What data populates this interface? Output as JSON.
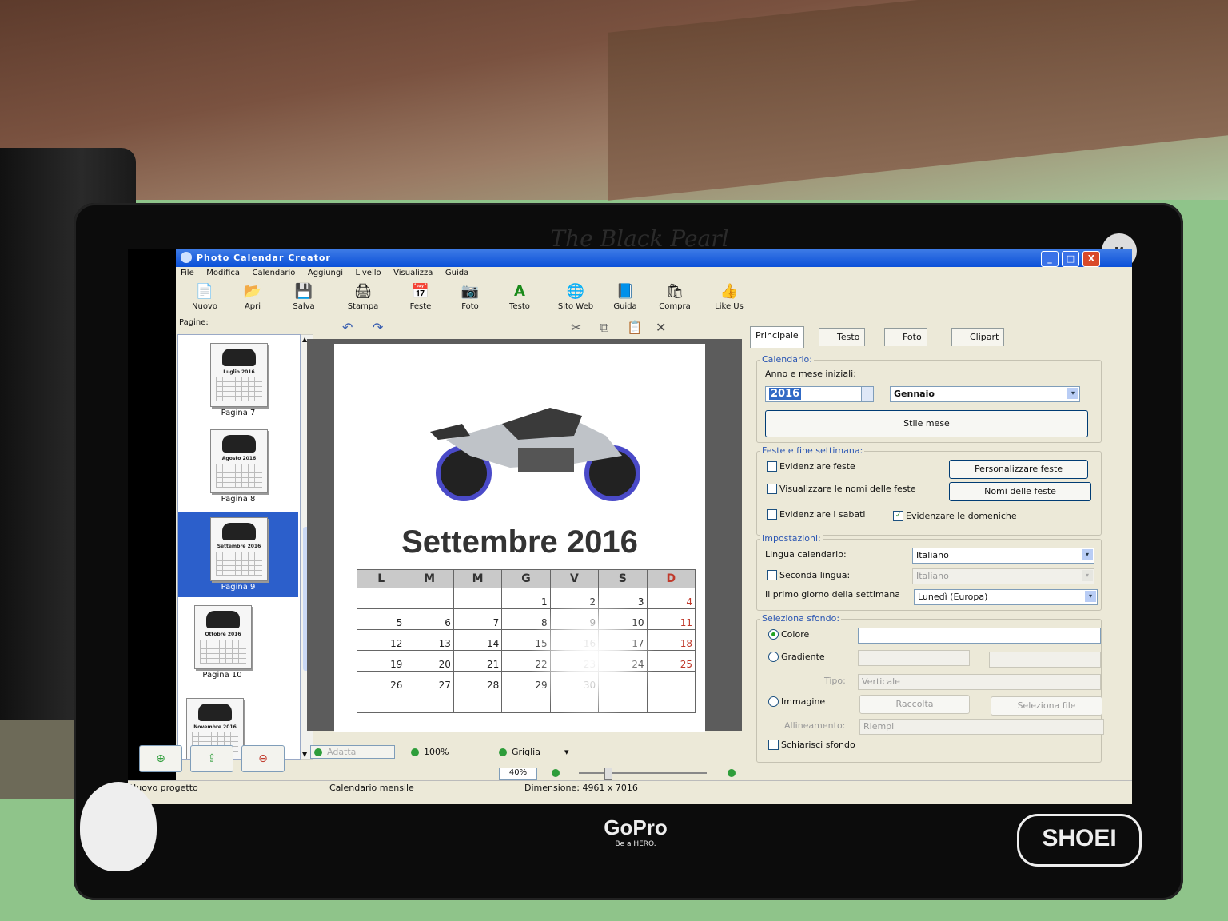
{
  "environment": {
    "monitor_brand": "The Black Pearl",
    "corner_badge": "M",
    "gopro_brand": "GoPro",
    "gopro_slogan": "Be a HERO.",
    "shoei_brand": "SHOEI"
  },
  "window": {
    "title": "Photo Calendar Creator",
    "minimize": "_",
    "maximize": "□",
    "close": "X"
  },
  "menu": [
    "File",
    "Modifica",
    "Calendario",
    "Aggiungi",
    "Livello",
    "Visualizza",
    "Guida"
  ],
  "toolbar": {
    "nuovo": "Nuovo",
    "apri": "Apri",
    "salva": "Salva",
    "stampa": "Stampa",
    "feste": "Feste",
    "foto": "Foto",
    "testo": "Testo",
    "sito_web": "Sito Web",
    "guida": "Guida",
    "compra": "Compra",
    "like_us": "Like Us"
  },
  "icons": {
    "nuovo": "📄",
    "apri": "📂",
    "salva": "💾",
    "stampa": "🖨",
    "feste": "📅",
    "foto": "📷",
    "testo": "A",
    "sito_web": "🌐",
    "guida": "📘",
    "compra": "🛍",
    "like_us": "👍",
    "undo": "↶",
    "redo": "↷",
    "cut": "✂",
    "copy": "⧉",
    "paste": "📋",
    "delete": "✕",
    "scroll_up": "▲",
    "scroll_down": "▼",
    "add_page": "⊕",
    "export_page": "⇪",
    "remove_page": "⊖",
    "dropdown": "▾"
  },
  "pages_panel": {
    "label": "Pagine:",
    "thumbnails": [
      {
        "month": "Luglio 2016",
        "label": "Pagina 7"
      },
      {
        "month": "Agosto 2016",
        "label": "Pagina 8"
      },
      {
        "month": "Settembre 2016",
        "label": "Pagina 9"
      },
      {
        "month": "Ottobre 2016",
        "label": "Pagina 10"
      },
      {
        "month": "Novembre 2016",
        "label": ""
      }
    ]
  },
  "calendar_page": {
    "title": "Settembre 2016",
    "weekdays": [
      "L",
      "M",
      "M",
      "G",
      "V",
      "S",
      "D"
    ],
    "weeks": [
      [
        "",
        "",
        "",
        "1",
        "2",
        "3",
        "4"
      ],
      [
        "5",
        "6",
        "7",
        "8",
        "9",
        "10",
        "11"
      ],
      [
        "12",
        "13",
        "14",
        "15",
        "16",
        "17",
        "18"
      ],
      [
        "19",
        "20",
        "21",
        "22",
        "23",
        "24",
        "25"
      ],
      [
        "26",
        "27",
        "28",
        "29",
        "30",
        "",
        ""
      ],
      [
        "",
        "",
        "",
        "",
        "",
        "",
        ""
      ]
    ]
  },
  "bottom_controls": {
    "adatta": "Adatta",
    "zoom_100": "100%",
    "griglia": "Griglia",
    "zoom_value": "40%"
  },
  "right_panel": {
    "tabs": [
      "Principale",
      "Testo",
      "Foto",
      "Clipart"
    ],
    "calendario": {
      "group_label": "Calendario:",
      "anno_label": "Anno e mese iniziali:",
      "anno_value": "2016",
      "mese_value": "Gennaio",
      "stile_mese": "Stile mese"
    },
    "feste": {
      "group_label": "Feste e fine settimana:",
      "evidenziare_feste": "Evidenziare feste",
      "personalizzare_feste": "Personalizzare feste",
      "visualizzare_nomi": "Visualizzare le nomi delle feste",
      "nomi_delle_feste": "Nomi delle feste",
      "evidenziare_sabati": "Evidenziare i sabati",
      "evidenziare_domeniche": "Evidenzare le domeniche"
    },
    "impostazioni": {
      "group_label": "Impostazioni:",
      "lingua_label": "Lingua calendario:",
      "lingua_value": "Italiano",
      "seconda_label": "Seconda lingua:",
      "seconda_value": "Italiano",
      "primo_giorno_label": "Il primo giorno della settimana",
      "primo_giorno_value": "Lunedì (Europa)"
    },
    "sfondo": {
      "group_label": "Seleziona sfondo:",
      "colore": "Colore",
      "gradiente": "Gradiente",
      "tipo_label": "Tipo:",
      "tipo_value": "Verticale",
      "immagine": "Immagine",
      "raccolta": "Raccolta",
      "seleziona_file": "Seleziona file",
      "allineamento_label": "Allineamento:",
      "allineamento_value": "Riempi",
      "schiarisci": "Schiarisci sfondo"
    }
  },
  "status": {
    "left": "Nuovo progetto",
    "middle": "Calendario mensile",
    "dimension": "Dimensione: 4961 x 7016"
  },
  "colors": {
    "titlebar": "#0b50d8",
    "selection": "#2c5fcb",
    "sunday": "#c0392b",
    "group_label": "#2b56b3"
  }
}
